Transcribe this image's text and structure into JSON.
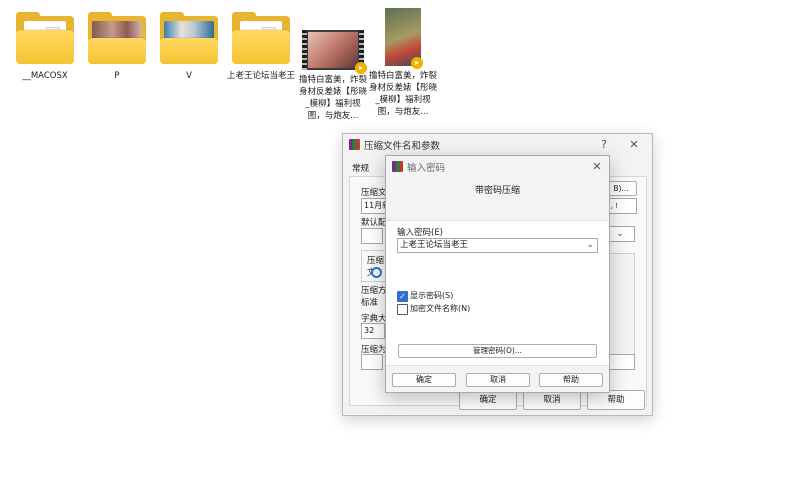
{
  "desktop": {
    "icons": [
      {
        "label": "__MACOSX",
        "type": "folder"
      },
      {
        "label": "P",
        "type": "folder-photo"
      },
      {
        "label": "V",
        "type": "folder-photo"
      },
      {
        "label": "上老王论坛当老王",
        "type": "folder"
      },
      {
        "label": "撸特白富美，炸裂身材反差婊【彤晓_模柳】福利视图，与炮友...",
        "type": "video"
      },
      {
        "label": "撸特白富美，炸裂身材反差婊【彤晓_模柳】福利视图，与炮友...",
        "type": "image"
      }
    ]
  },
  "archive_dialog": {
    "title": "压缩文件名和参数",
    "help_glyph": "?",
    "close_glyph": "✕",
    "tab_general": "常规",
    "archive_name_label": "压缩文",
    "archive_name_value": "11月新",
    "browse_suffix": "B)...",
    "method_suffix": "), !",
    "default_profile_label": "默认配",
    "format_label": "压缩文",
    "method_label": "压缩方",
    "method_value": "标准",
    "dict_label": "字典大",
    "dict_value": "32",
    "split_label": "压缩为",
    "ok": "确定",
    "cancel": "取消",
    "help": "帮助"
  },
  "password_dialog": {
    "title": "输入密码",
    "close_glyph": "✕",
    "heading": "带密码压缩",
    "password_label": "输入密码(E)",
    "password_value": "上老王论坛当老王",
    "show_password_label": "显示密码(S)",
    "show_password_checked": true,
    "encrypt_names_label": "加密文件名称(N)",
    "encrypt_names_checked": false,
    "manage_button": "管理密码(O)...",
    "ok": "确定",
    "cancel": "取消",
    "help": "帮助"
  }
}
